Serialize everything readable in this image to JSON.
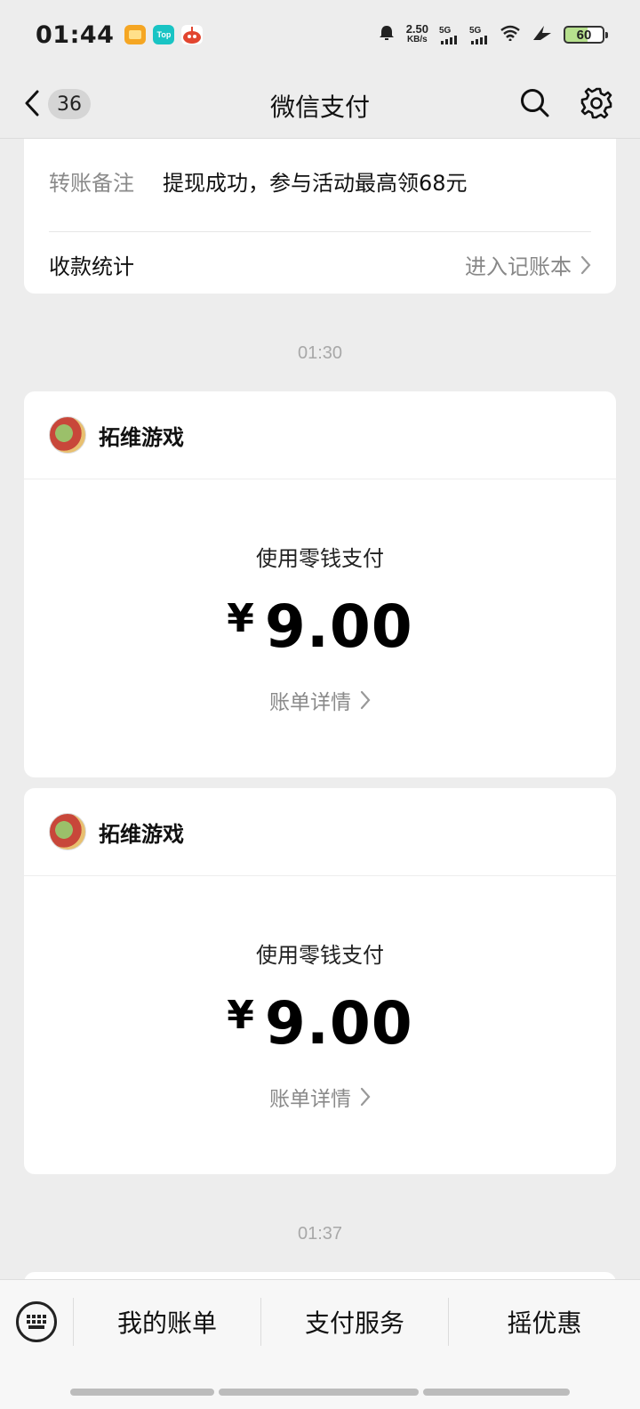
{
  "status_bar": {
    "time": "01:44",
    "app_top_label": "Top",
    "net_speed_value": "2.50",
    "net_speed_unit": "KB/s",
    "sim1_label": "5G",
    "sim2_label": "5G",
    "battery_level": "60"
  },
  "nav": {
    "unread_count": "36",
    "title": "微信支付"
  },
  "transfer_card": {
    "remark_label": "转账备注",
    "remark_value": "提现成功，参与活动最高领68元",
    "stats_label": "收款统计",
    "stats_link": "进入记账本"
  },
  "timestamps": [
    "01:30",
    "01:37"
  ],
  "payments": [
    {
      "merchant": "拓维游戏",
      "method": "使用零钱支付",
      "currency": "¥",
      "amount": "9.00",
      "details_link": "账单详情"
    },
    {
      "merchant": "拓维游戏",
      "method": "使用零钱支付",
      "currency": "¥",
      "amount": "9.00",
      "details_link": "账单详情"
    }
  ],
  "bottom_menu": {
    "items": [
      "我的账单",
      "支付服务",
      "摇优惠"
    ]
  },
  "icons": {
    "back": "chevron-left-icon",
    "search": "search-icon",
    "settings": "gear-icon",
    "keyboard": "keyboard-icon",
    "chevron": "chevron-right-icon"
  },
  "colors": {
    "background": "#ededed",
    "card": "#ffffff",
    "muted_text": "#8a8a8a"
  }
}
